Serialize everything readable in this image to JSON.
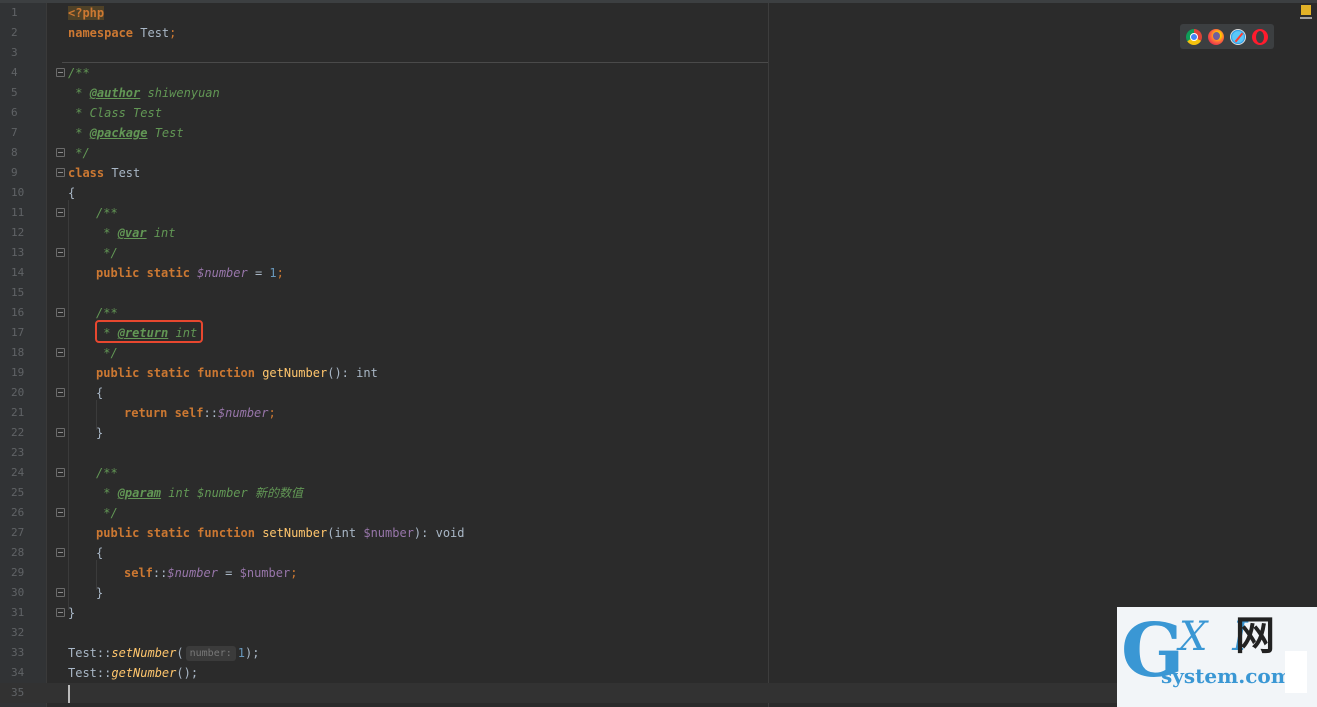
{
  "editor": {
    "line_numbers": [
      "1",
      "2",
      "3",
      "4",
      "5",
      "6",
      "7",
      "8",
      "9",
      "10",
      "11",
      "12",
      "13",
      "14",
      "15",
      "16",
      "17",
      "18",
      "19",
      "20",
      "21",
      "22",
      "23",
      "24",
      "25",
      "26",
      "27",
      "28",
      "29",
      "30",
      "31",
      "32",
      "33",
      "34",
      "35"
    ],
    "code": {
      "l1_php": "<?php",
      "l2_ns_kw": "namespace",
      "l2_ns_name": " Test",
      "l2_semi": ";",
      "l4": "/**",
      "l5_star": " * ",
      "l5_tag": "@author",
      "l5_val": " shiwenyuan",
      "l6": " * Class Test",
      "l7_star": " * ",
      "l7_tag": "@package",
      "l7_val": " Test",
      "l8": " */",
      "l9_kw": "class",
      "l9_name": " Test",
      "l10": "{",
      "l11": "/**",
      "l12_star": " * ",
      "l12_tag": "@var",
      "l12_val": " int",
      "l13": " */",
      "l14_kw": "public static",
      "l14_var": "$number",
      "l14_eq": " = ",
      "l14_num": "1",
      "l14_semi": ";",
      "l16": "/**",
      "l17_star": " * ",
      "l17_tag": "@return",
      "l17_val": " int",
      "l18": " */",
      "l19_kw": "public static function",
      "l19_fn": "getNumber",
      "l19_rest": "(): int",
      "l20": "{",
      "l21_kw": "return self",
      "l21_dc": "::",
      "l21_var": "$number",
      "l21_semi": ";",
      "l22": "}",
      "l24": "/**",
      "l25_star": " * ",
      "l25_tag": "@param",
      "l25_val": " int $number 新的数值",
      "l26": " */",
      "l27_kw": "public static function",
      "l27_fn": "setNumber",
      "l27_open": "(int ",
      "l27_var": "$number",
      "l27_close": "): void",
      "l28": "{",
      "l29_kw": "self",
      "l29_dc": "::",
      "l29_var1": "$number",
      "l29_eq": " = ",
      "l29_var2": "$number",
      "l29_semi": ";",
      "l30": "}",
      "l31": "}",
      "l33_cls": "Test",
      "l33_dc": "::",
      "l33_fn": "setNumber",
      "l33_open": "(",
      "l33_hint": "number:",
      "l33_num": "1",
      "l33_close": ");",
      "l34_cls": "Test",
      "l34_dc": "::",
      "l34_fn": "getNumber",
      "l34_close": "();"
    }
  },
  "browser_icons": [
    "chrome-icon",
    "firefox-icon",
    "safari-icon",
    "opera-icon"
  ],
  "watermark": {
    "g": "G",
    "xi": "X I",
    "wang": "网",
    "domain": "system.com"
  },
  "colors": {
    "background": "#2b2b2b",
    "keyword": "#cc7832",
    "doc_comment": "#629755",
    "variable": "#9876aa",
    "number": "#6897bb",
    "function": "#ffc66d",
    "highlight_box": "#e8472f"
  }
}
